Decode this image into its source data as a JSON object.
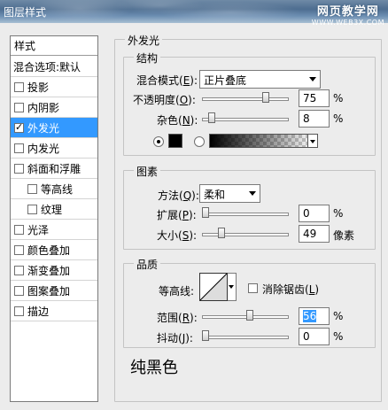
{
  "window": {
    "title": "图层样式",
    "watermark": "网页教学网",
    "watermark_url": "WWW.WEB3X.COM"
  },
  "style_list": {
    "header": "样式",
    "blend": "混合选项:默认",
    "items": [
      {
        "label": "投影",
        "checked": false
      },
      {
        "label": "内阴影",
        "checked": false
      },
      {
        "label": "外发光",
        "checked": true,
        "selected": true
      },
      {
        "label": "内发光",
        "checked": false
      },
      {
        "label": "斜面和浮雕",
        "checked": false
      },
      {
        "label": "等高线",
        "checked": false,
        "indent": true
      },
      {
        "label": "纹理",
        "checked": false,
        "indent": true
      },
      {
        "label": "光泽",
        "checked": false
      },
      {
        "label": "颜色叠加",
        "checked": false
      },
      {
        "label": "渐变叠加",
        "checked": false
      },
      {
        "label": "图案叠加",
        "checked": false
      },
      {
        "label": "描边",
        "checked": false
      }
    ]
  },
  "outer_glow": {
    "title": "外发光",
    "structure": {
      "title": "结构",
      "blend_mode_label": "混合模式(",
      "blend_mode_key": "E",
      "blend_mode_close": "):",
      "blend_mode": "正片叠底",
      "opacity_label": "不透明度(",
      "opacity_key": "O",
      "opacity_close": "):",
      "opacity": "75",
      "opacity_level": 0.75,
      "noise_label": "杂色(",
      "noise_key": "N",
      "noise_close": "):",
      "noise": "8",
      "noise_level": 0.08,
      "percent": "%",
      "color": "#000000"
    },
    "elements": {
      "title": "图素",
      "method_label": "方法(",
      "method_key": "Q",
      "method_close": "):",
      "method": "柔和",
      "spread_label": "扩展(",
      "spread_key": "P",
      "spread_close": "):",
      "spread": "0",
      "spread_level": 0,
      "size_label": "大小(",
      "size_key": "S",
      "size_close": "):",
      "size": "49",
      "size_level": 0.2,
      "percent": "%",
      "px": "像素"
    },
    "quality": {
      "title": "品质",
      "contour_label": "等高线:",
      "anti_alias_label": "消除锯齿(",
      "anti_alias_key": "L",
      "anti_alias_close": ")",
      "anti_alias": false,
      "range_label": "范围(",
      "range_key": "R",
      "range_close": "):",
      "range": "56",
      "range_level": 0.56,
      "jitter_label": "抖动(",
      "jitter_key": "J",
      "jitter_close": "):",
      "jitter": "0",
      "jitter_level": 0,
      "percent": "%"
    },
    "note": "纯黑色"
  }
}
